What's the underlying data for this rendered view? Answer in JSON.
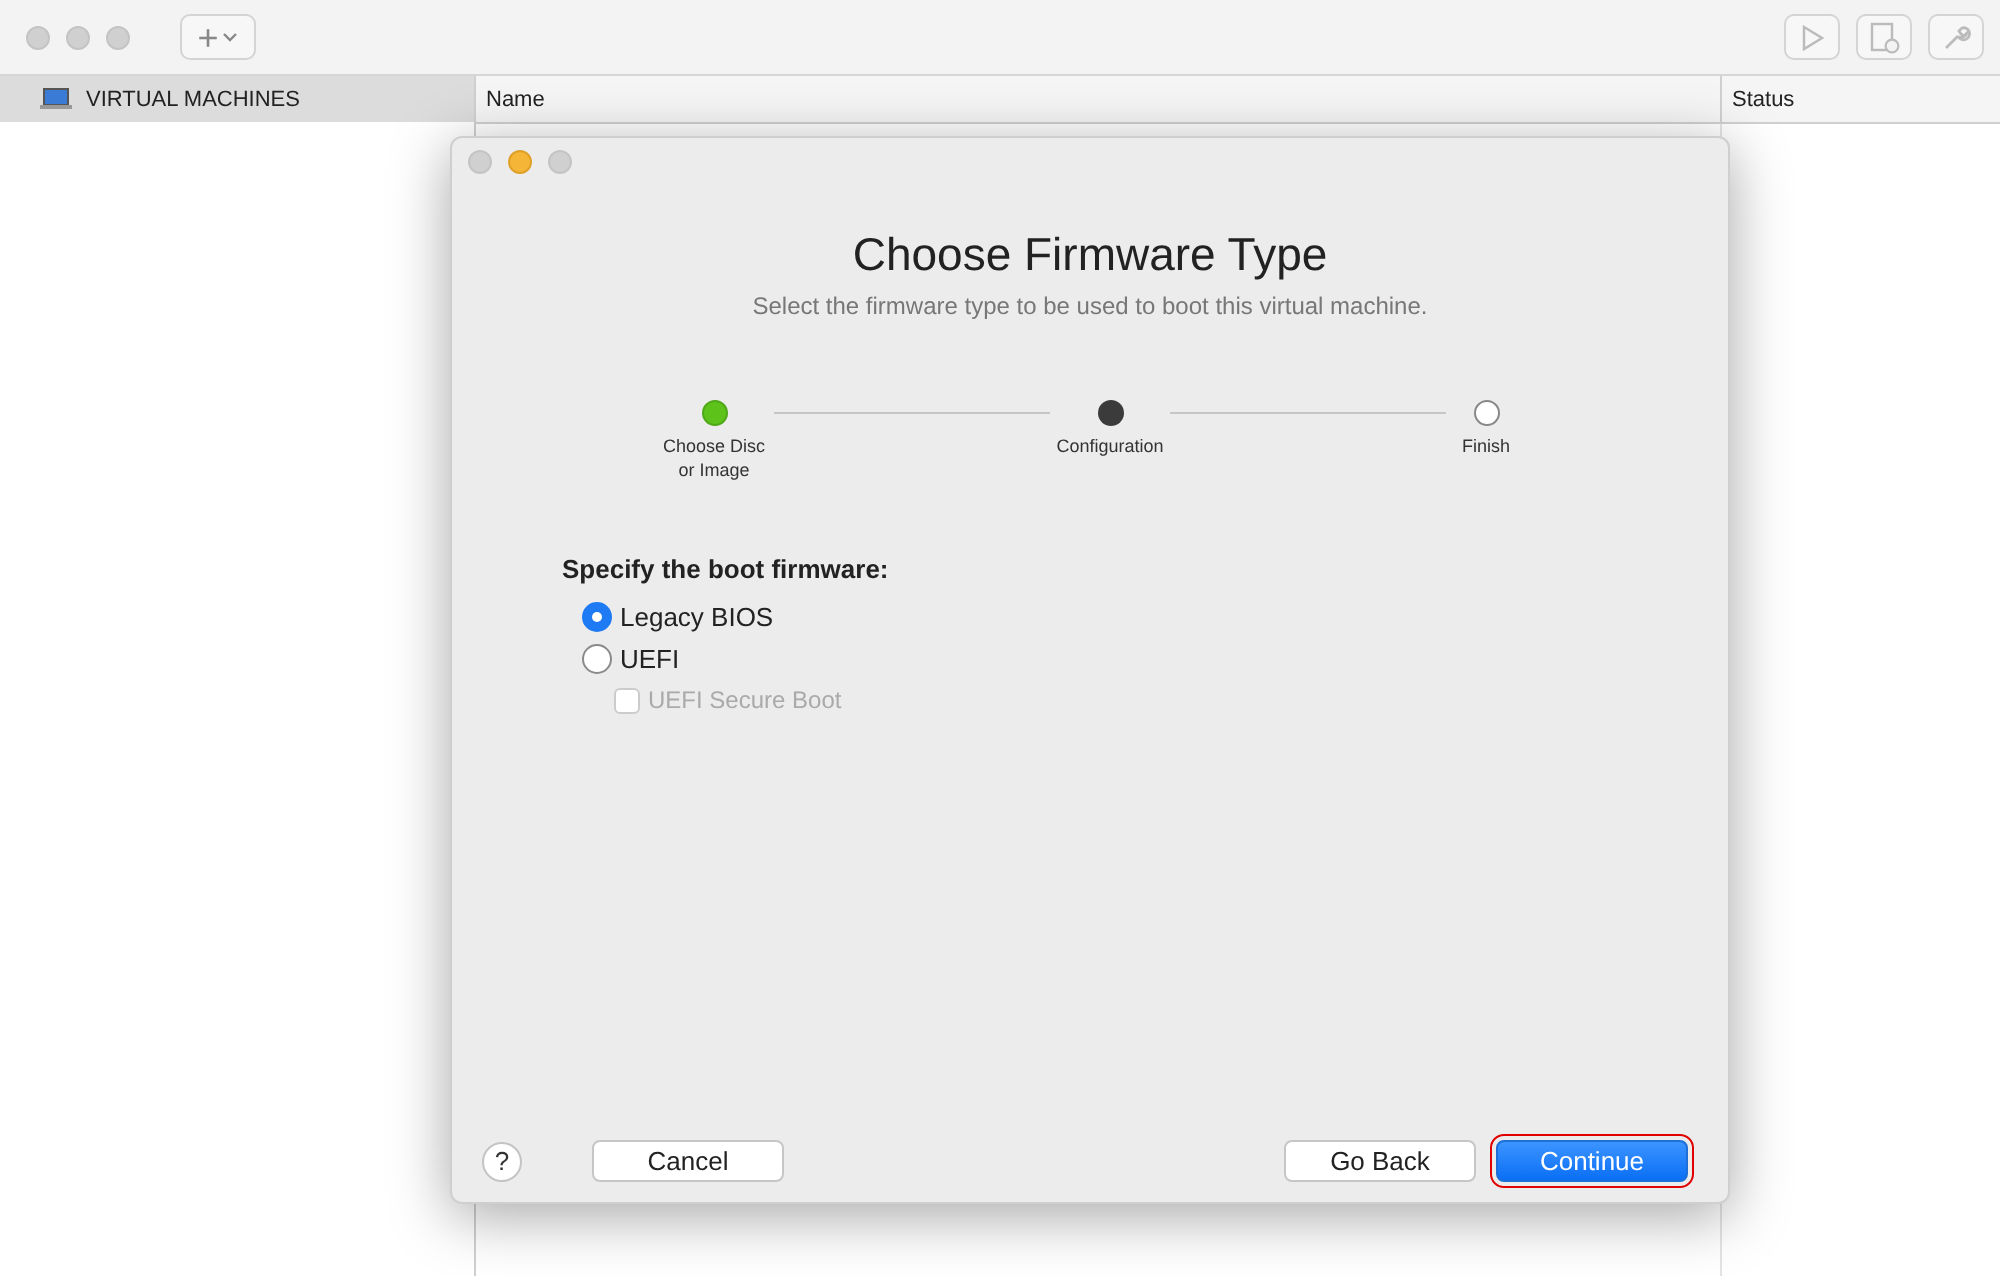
{
  "window": {
    "toolbar": {
      "add_button": "+"
    }
  },
  "sidebar": {
    "header": "VIRTUAL MACHINES"
  },
  "table": {
    "columns": [
      "Name",
      "Status"
    ]
  },
  "dialog": {
    "title": "Choose Firmware Type",
    "subtitle": "Select the firmware type to be used to boot this virtual machine.",
    "steps": [
      {
        "label": "Choose Disc\nor Image",
        "kind": "complete"
      },
      {
        "label": "Configuration",
        "kind": "current"
      },
      {
        "label": "Finish",
        "kind": "pending"
      }
    ],
    "section_label": "Specify the boot firmware:",
    "options": [
      {
        "kind": "radio",
        "label": "Legacy BIOS",
        "selected": true
      },
      {
        "kind": "radio",
        "label": "UEFI",
        "selected": false
      },
      {
        "kind": "checkbox",
        "label": "UEFI Secure Boot",
        "checked": false,
        "disabled": true
      }
    ],
    "help": "?",
    "buttons": [
      {
        "label": "Cancel",
        "kind": "normal"
      },
      {
        "label": "Go Back",
        "kind": "normal"
      },
      {
        "label": "Continue",
        "kind": "default"
      }
    ]
  }
}
